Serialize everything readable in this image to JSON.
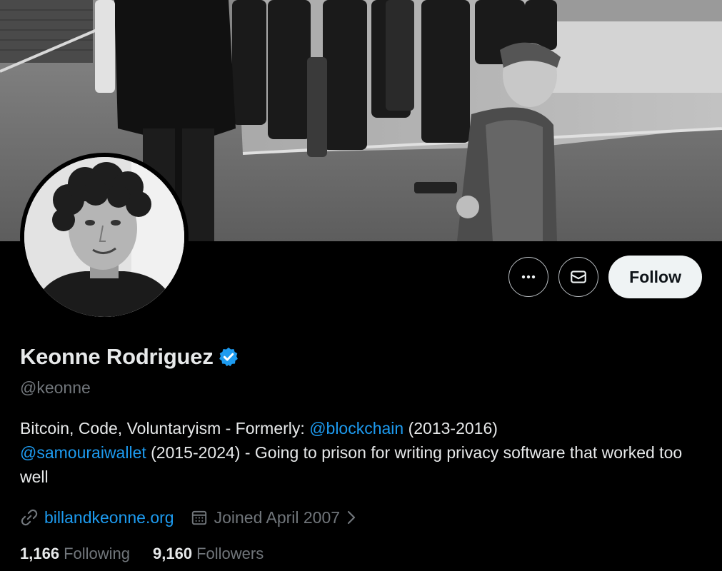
{
  "profile": {
    "display_name": "Keonne Rodriguez",
    "handle": "@keonne",
    "verified_icon": "verified-badge-icon",
    "bio": {
      "part1": "Bitcoin, Code, Voluntaryism - Formerly: ",
      "mention1": "@blockchain",
      "part2": " (2013-2016)",
      "mention2": "@samouraiwallet",
      "part3": " (2015-2024) - Going to prison for writing privacy software that worked too well"
    },
    "website": "billandkeonne.org",
    "joined": "Joined April 2007"
  },
  "actions": {
    "more_icon": "more-icon",
    "message_icon": "envelope-icon",
    "follow_label": "Follow"
  },
  "stats": {
    "following_count": "1,166",
    "following_label": "Following",
    "followers_count": "9,160",
    "followers_label": "Followers"
  },
  "colors": {
    "background": "#000000",
    "text_primary": "#e7e9ea",
    "text_secondary": "#71767b",
    "accent": "#1d9bf0",
    "follow_button": "#eff3f4"
  }
}
